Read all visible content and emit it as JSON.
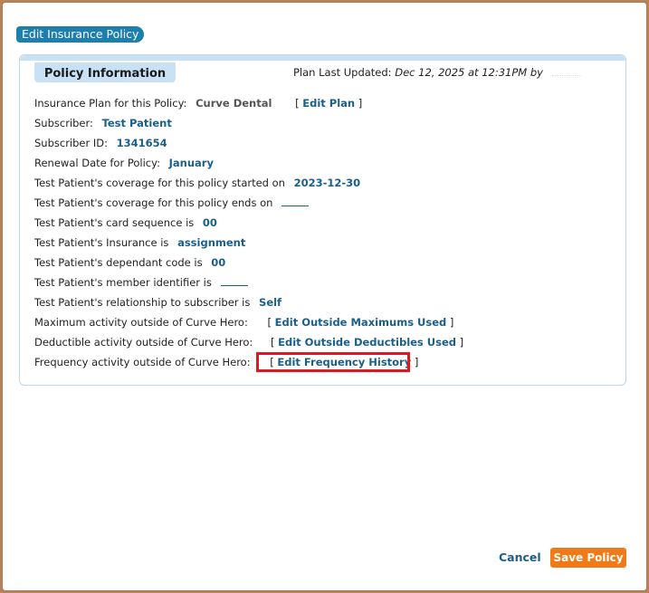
{
  "dialog": {
    "title": "Edit Insurance Policy"
  },
  "panel": {
    "tab_label": "Policy Information",
    "updated_label": "Plan Last Updated:",
    "updated_value": "Dec 12, 2025 at 12:31PM by"
  },
  "rows": {
    "plan_label": "Insurance Plan for this Policy:",
    "plan_value": "Curve Dental",
    "edit_plan": "Edit Plan",
    "subscriber_label": "Subscriber:",
    "subscriber_value": "Test Patient",
    "subscriber_id_label": "Subscriber ID:",
    "subscriber_id_value": "1341654",
    "renewal_label": "Renewal Date for Policy:",
    "renewal_value": "January",
    "coverage_start_label": "Test Patient's coverage for this policy started on",
    "coverage_start_value": "2023-12-30",
    "coverage_end_label": "Test Patient's coverage for this policy ends on",
    "card_seq_label": "Test Patient's card sequence is",
    "card_seq_value": "00",
    "insurance_label": "Test Patient's Insurance is",
    "insurance_value": "assignment",
    "dependant_label": "Test Patient's dependant code is",
    "dependant_value": "00",
    "member_label": "Test Patient's member identifier is",
    "relationship_label": "Test Patient's relationship to subscriber is",
    "relationship_value": "Self",
    "max_label": "Maximum activity outside of Curve Hero:",
    "max_link": "Edit Outside Maximums Used",
    "deduct_label": "Deductible activity outside of Curve Hero:",
    "deduct_link": "Edit Outside Deductibles Used",
    "freq_label": "Frequency activity outside of Curve Hero:",
    "freq_link": "Edit Frequency History"
  },
  "footer": {
    "cancel": "Cancel",
    "save": "Save Policy"
  },
  "colors": {
    "accent": "#1d7fae",
    "save": "#f07a18",
    "highlight": "#e01622"
  }
}
